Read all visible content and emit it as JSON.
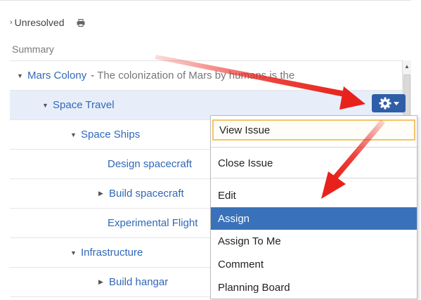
{
  "filter": {
    "chevron": "›",
    "label": "Unresolved",
    "print_icon": "printer-icon"
  },
  "columns": {
    "summary": "Summary"
  },
  "tree": [
    {
      "title": "Mars Colony",
      "description": "The colonization of Mars by humans is the",
      "expander": "expanded"
    },
    {
      "title": "Space Travel",
      "expander": "expanded",
      "selected": true
    },
    {
      "title": "Space Ships",
      "expander": "expanded"
    },
    {
      "title": "Design spacecraft",
      "expander": "none"
    },
    {
      "title": "Build spacecraft",
      "expander": "collapsed"
    },
    {
      "title": "Experimental Flight",
      "expander": "none"
    },
    {
      "title": "Infrastructure",
      "expander": "expanded"
    },
    {
      "title": "Build hangar",
      "expander": "collapsed"
    }
  ],
  "actions_button": {
    "icon": "gear-icon",
    "caret": "chevron-down-icon"
  },
  "menu": {
    "items": [
      "View Issue",
      "Close Issue",
      "Edit",
      "Assign",
      "Assign To Me",
      "Comment",
      "Planning Board"
    ],
    "focused": "View Issue",
    "highlighted": "Assign",
    "highlight_color": "#3a72ba",
    "focus_color": "#f3c36a"
  },
  "colors": {
    "link": "#3068b8",
    "selected_row": "#e7eef9",
    "button": "#2f5ea8",
    "annotation_arrow": "#e8221b"
  }
}
